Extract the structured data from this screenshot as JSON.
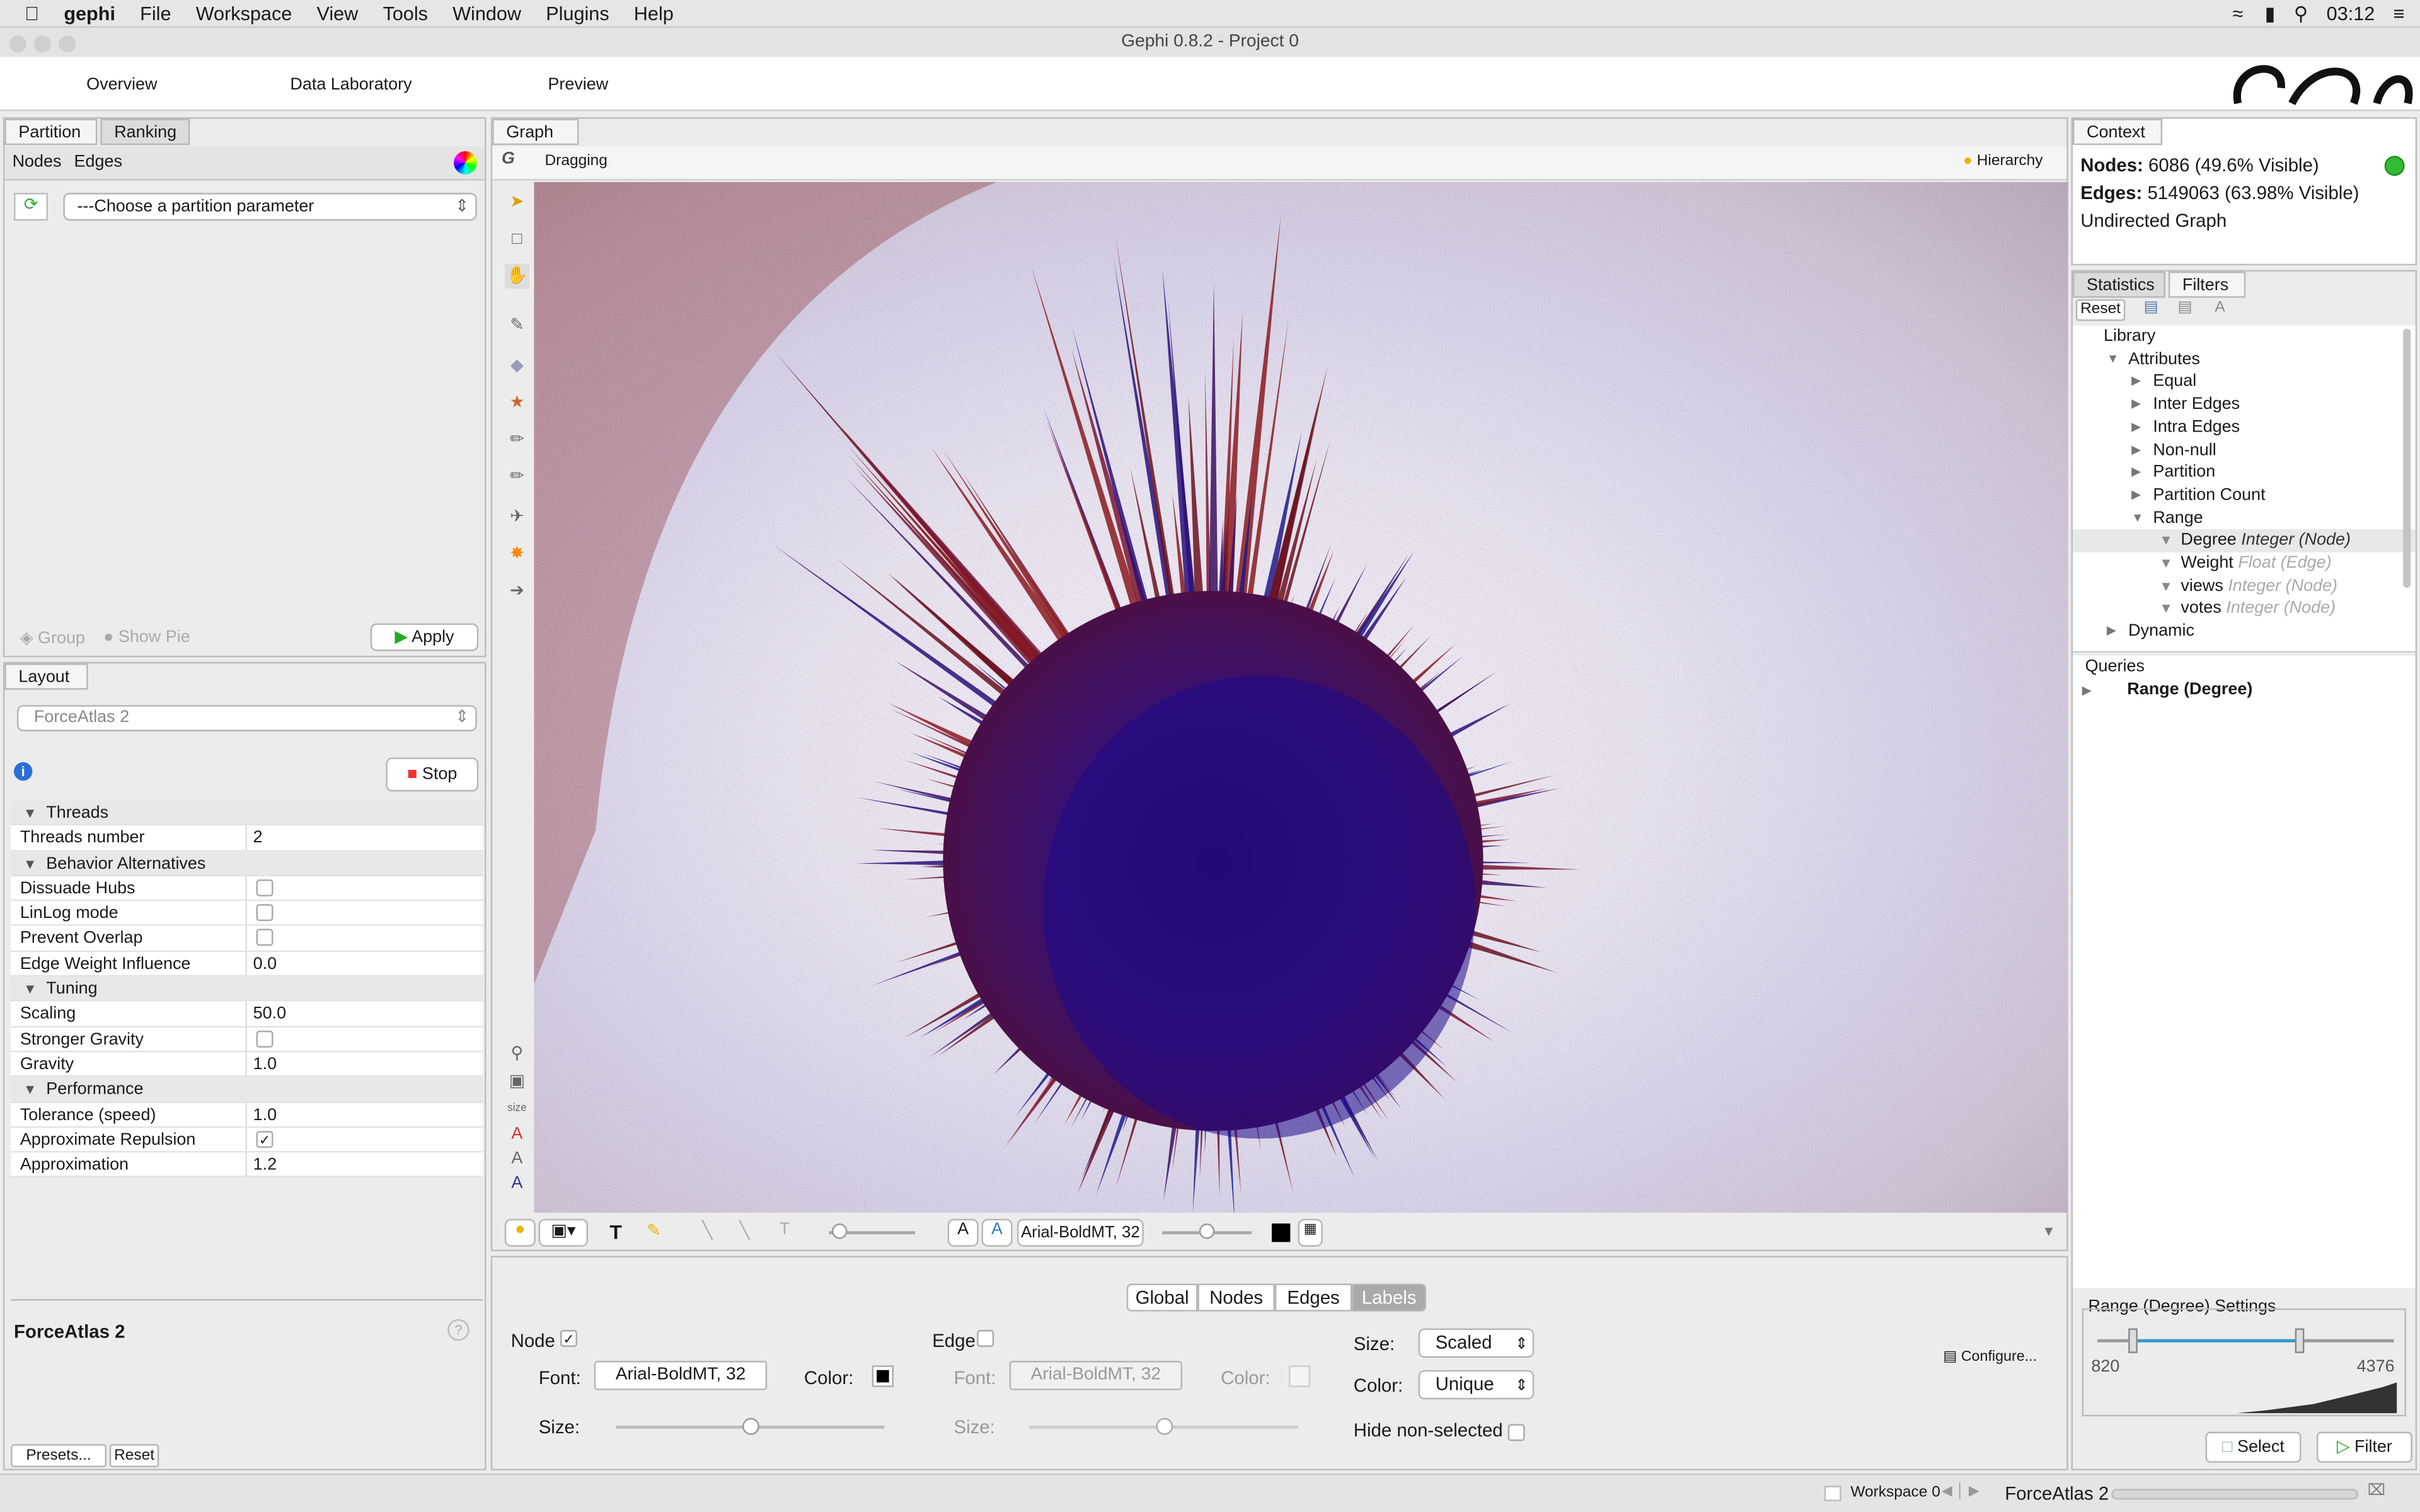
{
  "menu": {
    "apple": "",
    "app": "gephi",
    "items": [
      "File",
      "Workspace",
      "View",
      "Tools",
      "Window",
      "Plugins",
      "Help"
    ],
    "clock": "03:12"
  },
  "window": {
    "title": "Gephi 0.8.2 - Project 0"
  },
  "top_tabs": [
    "Overview",
    "Data Laboratory",
    "Preview"
  ],
  "partition": {
    "tabs": [
      "Partition",
      "Ranking"
    ],
    "subtabs": [
      "Nodes",
      "Edges"
    ],
    "parameter": "---Choose a partition parameter",
    "group": "Group",
    "show_pie": "Show Pie",
    "apply": "Apply"
  },
  "layout": {
    "tab": "Layout",
    "algorithm": "ForceAtlas 2",
    "stop": "Stop",
    "footer_title": "ForceAtlas 2",
    "presets": "Presets...",
    "reset": "Reset",
    "props": [
      {
        "k": "Threads",
        "cat": true
      },
      {
        "k": "Threads number",
        "v": "2"
      },
      {
        "k": "Behavior Alternatives",
        "cat": true
      },
      {
        "k": "Dissuade Hubs",
        "cb": false
      },
      {
        "k": "LinLog mode",
        "cb": false
      },
      {
        "k": "Prevent Overlap",
        "cb": false
      },
      {
        "k": "Edge Weight Influence",
        "v": "0.0"
      },
      {
        "k": "Tuning",
        "cat": true
      },
      {
        "k": "Scaling",
        "v": "50.0"
      },
      {
        "k": "Stronger Gravity",
        "cb": false
      },
      {
        "k": "Gravity",
        "v": "1.0"
      },
      {
        "k": "Performance",
        "cat": true
      },
      {
        "k": "Tolerance (speed)",
        "v": "1.0"
      },
      {
        "k": "Approximate Repulsion",
        "cb": true
      },
      {
        "k": "Approximation",
        "v": "1.2"
      }
    ]
  },
  "graph": {
    "tab": "Graph",
    "mode": "Dragging",
    "hierarchy": "Hierarchy",
    "font": "Arial-BoldMT, 32"
  },
  "labels": {
    "tabs": [
      "Global",
      "Nodes",
      "Edges",
      "Labels"
    ],
    "node": "Node",
    "edge": "Edge",
    "font_label": "Font:",
    "font": "Arial-BoldMT, 32",
    "color_label": "Color:",
    "size_label": "Size:",
    "size_mode": "Scaled",
    "color_mode": "Unique",
    "hide_non_selected": "Hide non-selected",
    "configure": "Configure..."
  },
  "context": {
    "tab": "Context",
    "nodes_label": "Nodes:",
    "nodes": "6086 (49.6% Visible)",
    "edges_label": "Edges:",
    "edges": "5149063 (63.98% Visible)",
    "type": "Undirected Graph"
  },
  "filters": {
    "tabs": [
      "Statistics",
      "Filters"
    ],
    "reset": "Reset",
    "library": [
      {
        "t": "Library",
        "l": 0
      },
      {
        "t": "Attributes",
        "l": 1,
        "o": true
      },
      {
        "t": "Equal",
        "l": 2
      },
      {
        "t": "Inter Edges",
        "l": 2
      },
      {
        "t": "Intra Edges",
        "l": 2
      },
      {
        "t": "Non-null",
        "l": 2
      },
      {
        "t": "Partition",
        "l": 2
      },
      {
        "t": "Partition Count",
        "l": 2
      },
      {
        "t": "Range",
        "l": 2,
        "o": true
      },
      {
        "t": "Degree",
        "h": "Integer (Node)",
        "l": 3,
        "sel": true
      },
      {
        "t": "Weight",
        "h": "Float (Edge)",
        "l": 3
      },
      {
        "t": "views",
        "h": "Integer (Node)",
        "l": 3
      },
      {
        "t": "votes",
        "h": "Integer (Node)",
        "l": 3
      },
      {
        "t": "Dynamic",
        "l": 1
      }
    ],
    "queries": "Queries",
    "query": "Range (Degree)",
    "settings_title": "Range (Degree) Settings",
    "min": "820",
    "max": "4376",
    "select": "Select",
    "filter": "Filter"
  },
  "status": {
    "workspace": "Workspace 0",
    "layout": "ForceAtlas 2"
  }
}
